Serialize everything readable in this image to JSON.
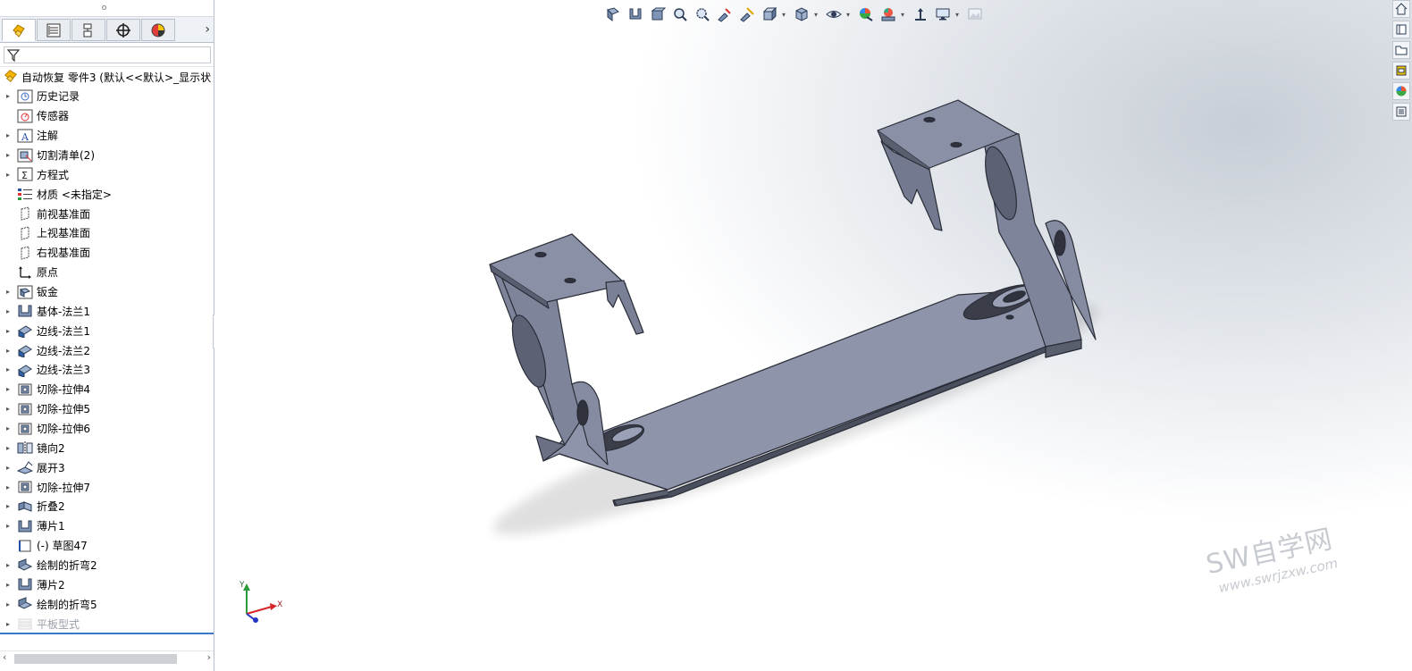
{
  "feature_tree": {
    "root_label": "自动恢复 零件3  (默认<<默认>_显示状",
    "items": [
      {
        "label": "历史记录",
        "arrow": true,
        "icon": "history-icon"
      },
      {
        "label": "传感器",
        "arrow": false,
        "icon": "sensor-icon"
      },
      {
        "label": "注解",
        "arrow": true,
        "icon": "annotation-icon"
      },
      {
        "label": "切割清单(2)",
        "arrow": true,
        "icon": "cut-list-icon"
      },
      {
        "label": "方程式",
        "arrow": true,
        "icon": "equation-icon"
      },
      {
        "label": "材质 <未指定>",
        "arrow": false,
        "icon": "material-icon"
      },
      {
        "label": "前视基准面",
        "arrow": false,
        "icon": "plane-icon"
      },
      {
        "label": "上视基准面",
        "arrow": false,
        "icon": "plane-icon"
      },
      {
        "label": "右视基准面",
        "arrow": false,
        "icon": "plane-icon"
      },
      {
        "label": "原点",
        "arrow": false,
        "icon": "origin-icon"
      },
      {
        "label": "钣金",
        "arrow": true,
        "icon": "sheet-metal-icon"
      },
      {
        "label": "基体-法兰1",
        "arrow": true,
        "icon": "base-flange-icon"
      },
      {
        "label": "边线-法兰1",
        "arrow": true,
        "icon": "edge-flange-icon"
      },
      {
        "label": "边线-法兰2",
        "arrow": true,
        "icon": "edge-flange-icon"
      },
      {
        "label": "边线-法兰3",
        "arrow": true,
        "icon": "edge-flange-icon"
      },
      {
        "label": "切除-拉伸4",
        "arrow": true,
        "icon": "cut-extrude-icon"
      },
      {
        "label": "切除-拉伸5",
        "arrow": true,
        "icon": "cut-extrude-icon"
      },
      {
        "label": "切除-拉伸6",
        "arrow": true,
        "icon": "cut-extrude-icon"
      },
      {
        "label": "镜向2",
        "arrow": true,
        "icon": "mirror-icon"
      },
      {
        "label": "展开3",
        "arrow": true,
        "icon": "unfold-icon"
      },
      {
        "label": "切除-拉伸7",
        "arrow": true,
        "icon": "cut-extrude-icon"
      },
      {
        "label": "折叠2",
        "arrow": true,
        "icon": "fold-icon"
      },
      {
        "label": "薄片1",
        "arrow": true,
        "icon": "tab-feature-icon"
      },
      {
        "label": "(-) 草图47",
        "arrow": false,
        "icon": "sketch-icon"
      },
      {
        "label": "绘制的折弯2",
        "arrow": true,
        "icon": "sketched-bend-icon"
      },
      {
        "label": "薄片2",
        "arrow": true,
        "icon": "tab-feature-icon"
      },
      {
        "label": "绘制的折弯5",
        "arrow": true,
        "icon": "sketched-bend-icon"
      },
      {
        "label": "平板型式",
        "arrow": true,
        "icon": "flat-pattern-icon",
        "dim": true
      }
    ]
  },
  "watermark": {
    "main": "SW自学网",
    "sub": "www.swrjzxw.com"
  },
  "triad": {
    "x": "X",
    "y": "Y"
  },
  "colors": {
    "part": "#8c92a6",
    "part_edge": "#2a2d38",
    "accent": "#3b78c8"
  }
}
